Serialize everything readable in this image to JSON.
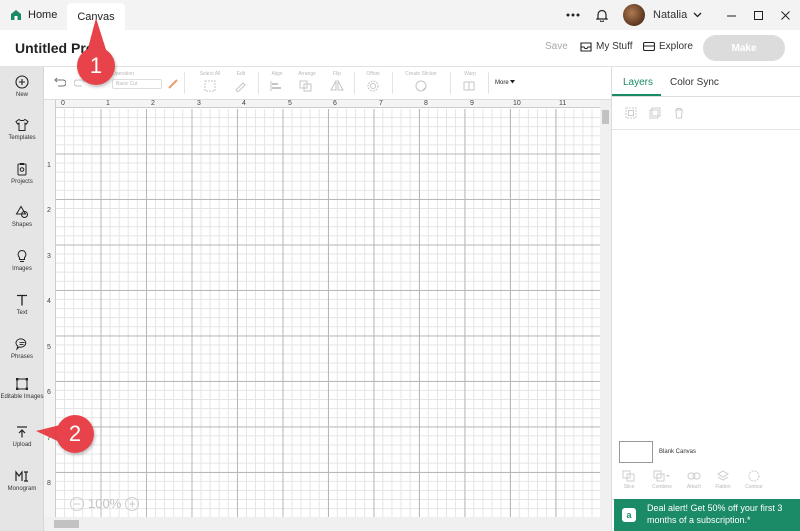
{
  "titlebar": {
    "home_tab": "Home",
    "canvas_tab": "Canvas",
    "user_name": "Natalia"
  },
  "header": {
    "project_title": "Untitled Pro",
    "save_label": "Save",
    "my_stuff_label": "My Stuff",
    "explore_label": "Explore",
    "make_label": "Make"
  },
  "sidebar": {
    "items": [
      {
        "label": "New",
        "icon": "plus-circle-icon"
      },
      {
        "label": "Templates",
        "icon": "shirt-icon"
      },
      {
        "label": "Projects",
        "icon": "clipboard-icon"
      },
      {
        "label": "Shapes",
        "icon": "shapes-icon"
      },
      {
        "label": "Images",
        "icon": "bulb-icon"
      },
      {
        "label": "Text",
        "icon": "text-icon"
      },
      {
        "label": "Phrases",
        "icon": "speech-bubble-icon"
      },
      {
        "label": "Editable Images",
        "icon": "editable-image-icon"
      },
      {
        "label": "Upload",
        "icon": "upload-icon"
      },
      {
        "label": "Monogram",
        "icon": "monogram-icon"
      }
    ]
  },
  "toolbar": {
    "operation_label": "Operation",
    "operation_value": "Basic Cut",
    "select_all": "Select All",
    "edit": "Edit",
    "align": "Align",
    "arrange": "Arrange",
    "flip": "Flip",
    "offset": "Offset",
    "create_sticker": "Create Sticker",
    "warp": "Warp",
    "more": "More"
  },
  "ruler": {
    "top": [
      "0",
      "1",
      "2",
      "3",
      "4",
      "5",
      "6",
      "7",
      "8",
      "9",
      "10",
      "11"
    ],
    "left": [
      "1",
      "2",
      "3",
      "4",
      "5",
      "6",
      "7",
      "8"
    ]
  },
  "zoom": {
    "value": "100%"
  },
  "right_panel": {
    "tab_layers": "Layers",
    "tab_color_sync": "Color Sync",
    "blank_canvas_label": "Blank Canvas",
    "bottom_tools": [
      "Slice",
      "Combine",
      "Attach",
      "Flatten",
      "Contour"
    ],
    "deal_text": "Deal alert! Get 50% off your first 3 months of a subscription.*"
  },
  "callouts": [
    "1",
    "2"
  ],
  "colors": {
    "accent": "#1b8a67",
    "callout": "#e8434a",
    "make_disabled": "#dcdcdc"
  }
}
